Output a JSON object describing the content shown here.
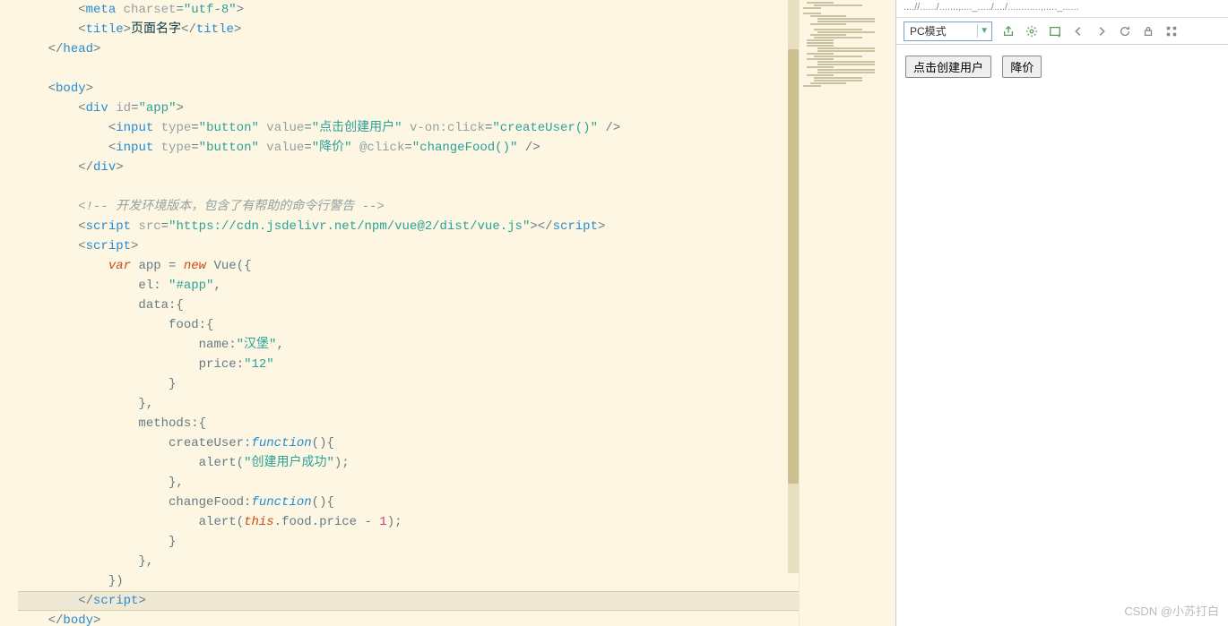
{
  "editor": {
    "lines": [
      {
        "indent": 2,
        "tokens": [
          [
            "punct",
            "<"
          ],
          [
            "tag",
            "meta"
          ],
          [
            "punct",
            " "
          ],
          [
            "attr-name",
            "charset"
          ],
          [
            "punct",
            "="
          ],
          [
            "attr-val",
            "\"utf-8\""
          ],
          [
            "punct",
            ">"
          ]
        ]
      },
      {
        "indent": 2,
        "tokens": [
          [
            "punct",
            "<"
          ],
          [
            "tag",
            "title"
          ],
          [
            "punct",
            ">"
          ],
          [
            "text",
            "页面名字"
          ],
          [
            "punct",
            "</"
          ],
          [
            "tag",
            "title"
          ],
          [
            "punct",
            ">"
          ]
        ]
      },
      {
        "indent": 1,
        "tokens": [
          [
            "punct",
            "</"
          ],
          [
            "tag",
            "head"
          ],
          [
            "punct",
            ">"
          ]
        ]
      },
      {
        "indent": 0,
        "tokens": []
      },
      {
        "indent": 1,
        "tokens": [
          [
            "punct",
            "<"
          ],
          [
            "tag",
            "body"
          ],
          [
            "punct",
            ">"
          ]
        ]
      },
      {
        "indent": 2,
        "tokens": [
          [
            "punct",
            "<"
          ],
          [
            "tag",
            "div"
          ],
          [
            "punct",
            " "
          ],
          [
            "attr-name",
            "id"
          ],
          [
            "punct",
            "="
          ],
          [
            "attr-val",
            "\"app\""
          ],
          [
            "punct",
            ">"
          ]
        ]
      },
      {
        "indent": 3,
        "tokens": [
          [
            "punct",
            "<"
          ],
          [
            "tag",
            "input"
          ],
          [
            "punct",
            " "
          ],
          [
            "attr-name",
            "type"
          ],
          [
            "punct",
            "="
          ],
          [
            "attr-val",
            "\"button\""
          ],
          [
            "punct",
            " "
          ],
          [
            "attr-name",
            "value"
          ],
          [
            "punct",
            "="
          ],
          [
            "attr-val",
            "\"点击创建用户\""
          ],
          [
            "punct",
            " "
          ],
          [
            "attr-name",
            "v-on:click"
          ],
          [
            "punct",
            "="
          ],
          [
            "attr-val",
            "\"createUser()\""
          ],
          [
            "punct",
            " />"
          ]
        ]
      },
      {
        "indent": 3,
        "tokens": [
          [
            "punct",
            "<"
          ],
          [
            "tag",
            "input"
          ],
          [
            "punct",
            " "
          ],
          [
            "attr-name",
            "type"
          ],
          [
            "punct",
            "="
          ],
          [
            "attr-val",
            "\"button\""
          ],
          [
            "punct",
            " "
          ],
          [
            "attr-name",
            "value"
          ],
          [
            "punct",
            "="
          ],
          [
            "attr-val",
            "\"降价\""
          ],
          [
            "punct",
            " "
          ],
          [
            "attr-name",
            "@click"
          ],
          [
            "punct",
            "="
          ],
          [
            "attr-val",
            "\"changeFood()\""
          ],
          [
            "punct",
            " />"
          ]
        ]
      },
      {
        "indent": 2,
        "tokens": [
          [
            "punct",
            "</"
          ],
          [
            "tag",
            "div"
          ],
          [
            "punct",
            ">"
          ]
        ]
      },
      {
        "indent": 0,
        "tokens": []
      },
      {
        "indent": 2,
        "tokens": [
          [
            "comment",
            "<!-- 开发环境版本，包含了有帮助的命令行警告 -->"
          ]
        ]
      },
      {
        "indent": 2,
        "tokens": [
          [
            "punct",
            "<"
          ],
          [
            "tag",
            "script"
          ],
          [
            "punct",
            " "
          ],
          [
            "attr-name",
            "src"
          ],
          [
            "punct",
            "="
          ],
          [
            "attr-val",
            "\"https://cdn.jsdelivr.net/npm/vue@2/dist/vue.js\""
          ],
          [
            "punct",
            "></"
          ],
          [
            "tag",
            "script"
          ],
          [
            "punct",
            ">"
          ]
        ]
      },
      {
        "indent": 2,
        "tokens": [
          [
            "punct",
            "<"
          ],
          [
            "tag",
            "script"
          ],
          [
            "punct",
            ">"
          ]
        ]
      },
      {
        "indent": 3,
        "tokens": [
          [
            "keyword",
            "var"
          ],
          [
            "punct",
            " app = "
          ],
          [
            "keyword",
            "new"
          ],
          [
            "punct",
            " "
          ],
          [
            "prop",
            "Vue"
          ],
          [
            "punct",
            "({"
          ]
        ]
      },
      {
        "indent": 4,
        "tokens": [
          [
            "prop",
            "el"
          ],
          [
            "punct",
            ": "
          ],
          [
            "string",
            "\"#app\""
          ],
          [
            "punct",
            ","
          ]
        ]
      },
      {
        "indent": 4,
        "tokens": [
          [
            "prop",
            "data"
          ],
          [
            "punct",
            ":{"
          ]
        ]
      },
      {
        "indent": 5,
        "tokens": [
          [
            "prop",
            "food"
          ],
          [
            "punct",
            ":{"
          ]
        ]
      },
      {
        "indent": 6,
        "tokens": [
          [
            "prop",
            "name"
          ],
          [
            "punct",
            ":"
          ],
          [
            "string",
            "\"汉堡\""
          ],
          [
            "punct",
            ","
          ]
        ]
      },
      {
        "indent": 6,
        "tokens": [
          [
            "prop",
            "price"
          ],
          [
            "punct",
            ":"
          ],
          [
            "string",
            "\"12\""
          ]
        ]
      },
      {
        "indent": 5,
        "tokens": [
          [
            "punct",
            "}"
          ]
        ]
      },
      {
        "indent": 4,
        "tokens": [
          [
            "punct",
            "},"
          ]
        ]
      },
      {
        "indent": 4,
        "tokens": [
          [
            "prop",
            "methods"
          ],
          [
            "punct",
            ":{"
          ]
        ]
      },
      {
        "indent": 5,
        "tokens": [
          [
            "prop",
            "createUser"
          ],
          [
            "punct",
            ":"
          ],
          [
            "func",
            "function"
          ],
          [
            "punct",
            "(){"
          ]
        ]
      },
      {
        "indent": 6,
        "tokens": [
          [
            "prop",
            "alert"
          ],
          [
            "punct",
            "("
          ],
          [
            "string",
            "\"创建用户成功\""
          ],
          [
            "punct",
            ");"
          ]
        ]
      },
      {
        "indent": 5,
        "tokens": [
          [
            "punct",
            "},"
          ]
        ]
      },
      {
        "indent": 5,
        "tokens": [
          [
            "prop",
            "changeFood"
          ],
          [
            "punct",
            ":"
          ],
          [
            "func",
            "function"
          ],
          [
            "punct",
            "(){"
          ]
        ]
      },
      {
        "indent": 6,
        "tokens": [
          [
            "prop",
            "alert"
          ],
          [
            "punct",
            "("
          ],
          [
            "keyword",
            "this"
          ],
          [
            "punct",
            ".food.price - "
          ],
          [
            "num",
            "1"
          ],
          [
            "punct",
            ");"
          ]
        ]
      },
      {
        "indent": 5,
        "tokens": [
          [
            "punct",
            "}"
          ]
        ]
      },
      {
        "indent": 4,
        "tokens": [
          [
            "punct",
            "},"
          ]
        ]
      },
      {
        "indent": 3,
        "tokens": [
          [
            "punct",
            "})"
          ]
        ]
      },
      {
        "indent": 2,
        "highlight": true,
        "tokens": [
          [
            "punct",
            "</"
          ],
          [
            "tag",
            "script"
          ],
          [
            "punct",
            ">"
          ]
        ]
      },
      {
        "indent": 1,
        "tokens": [
          [
            "punct",
            "</"
          ],
          [
            "tag",
            "body"
          ],
          [
            "punct",
            ">"
          ]
        ]
      }
    ]
  },
  "devtools": {
    "url_stub": "....//....../.......,...._...../..../............,....._......",
    "mode_label": "PC模式",
    "buttons": {
      "create_user": "点击创建用户",
      "discount": "降价"
    }
  },
  "watermark": "CSDN @小苏打白"
}
